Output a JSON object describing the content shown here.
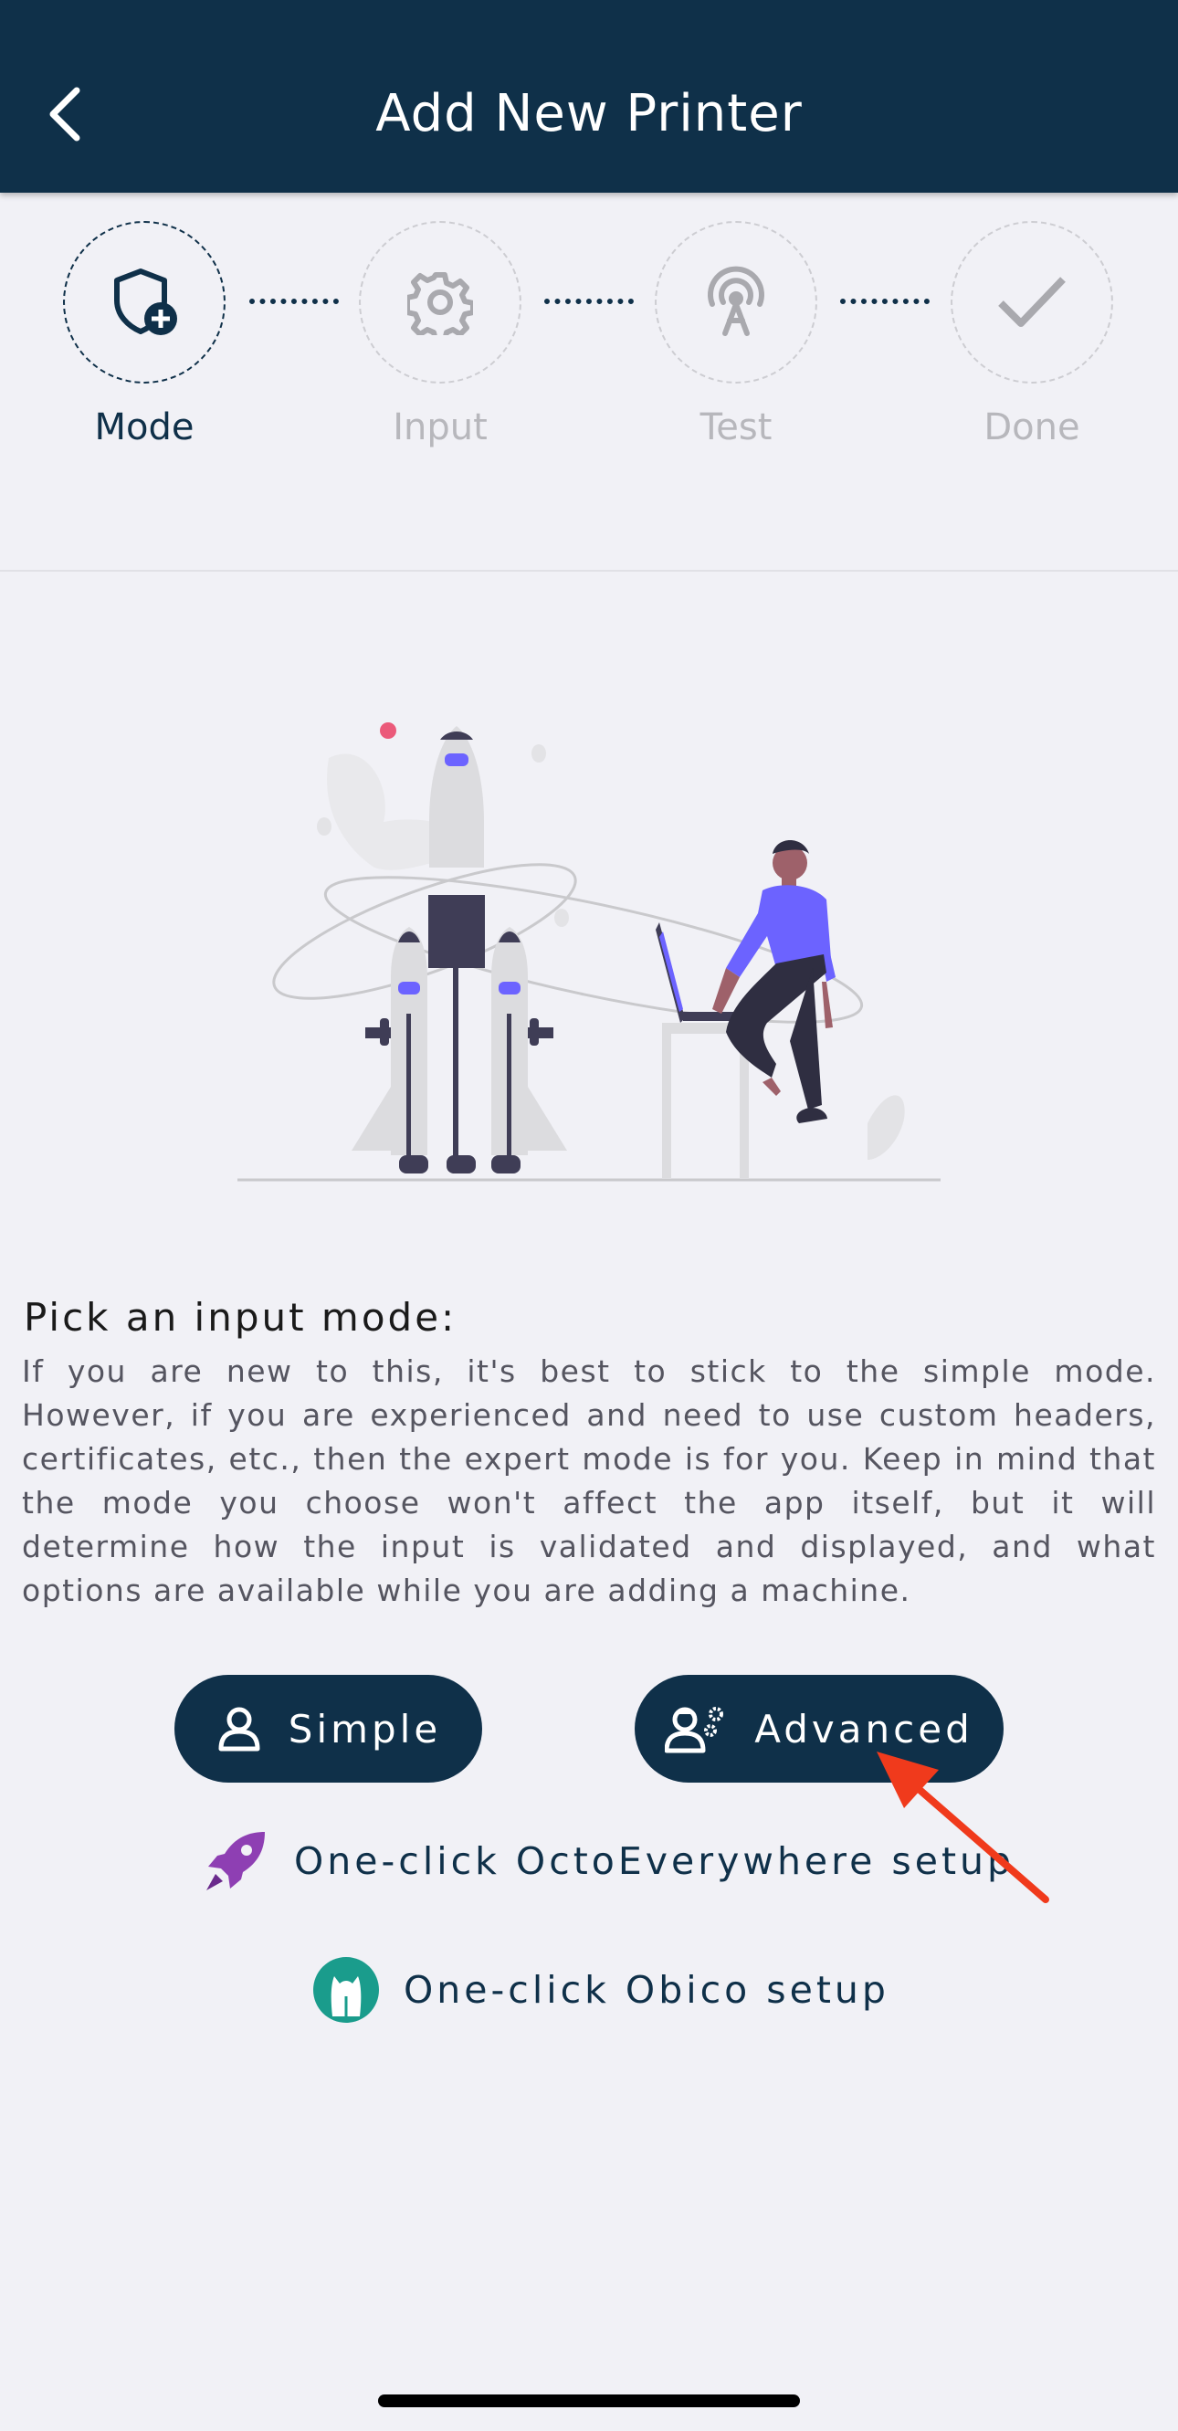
{
  "header": {
    "title": "Add New Printer",
    "background_color": "#0f3049",
    "back_icon": "chevron-left-icon"
  },
  "stepper": {
    "steps": [
      {
        "label": "Mode",
        "icon": "shield-plus-icon",
        "state": "active"
      },
      {
        "label": "Input",
        "icon": "gear-icon",
        "state": "inactive"
      },
      {
        "label": "Test",
        "icon": "signal-tower-icon",
        "state": "inactive"
      },
      {
        "label": "Done",
        "icon": "checkmark-icon",
        "state": "inactive"
      }
    ]
  },
  "content": {
    "heading": "Pick an input mode:",
    "description": "If you are new to this, it's best to stick to the simple mode. However, if you are experienced and need to use custom headers, certificates, etc., then the expert mode is for you. Keep in mind that the mode you choose won't affect the app itself, but it will determine how the input is validated and displayed, and what options are available while you are adding a machine."
  },
  "buttons": {
    "simple": {
      "label": "Simple",
      "icon": "person-icon"
    },
    "advanced": {
      "label": "Advanced",
      "icon": "person-gears-icon"
    }
  },
  "links": {
    "octoeverywhere": {
      "label": "One-click OctoEverywhere setup",
      "icon": "rocket-icon",
      "icon_color": "#8e3fb3"
    },
    "obico": {
      "label": "One-click Obico setup",
      "icon": "obico-logo-icon",
      "icon_color": "#1a9c8c"
    }
  },
  "annotation": {
    "arrow_color": "#f03a1c"
  }
}
